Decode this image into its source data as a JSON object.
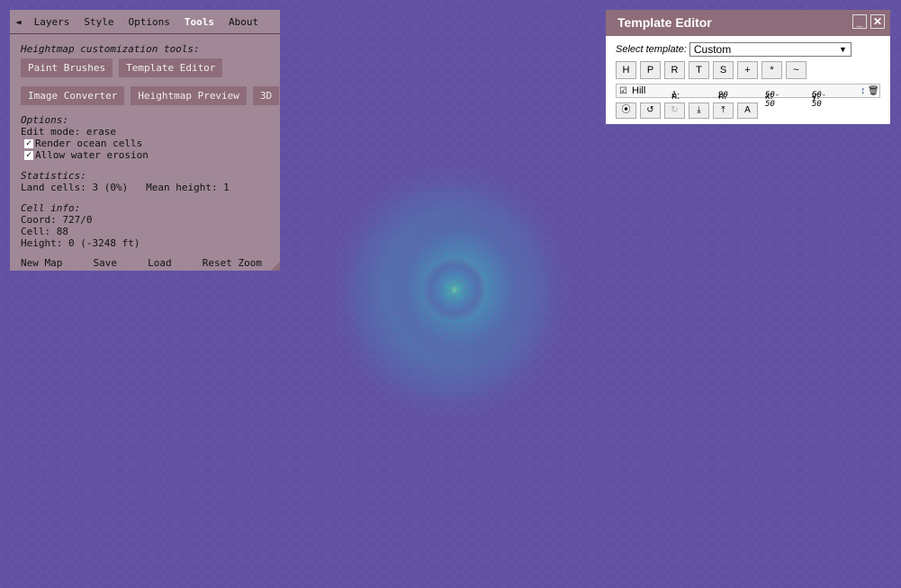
{
  "colors": {
    "ocean": "#6251a3",
    "panel": "#a58c96",
    "panel_button": "#8e6c79",
    "title_bar": "#8e6c79"
  },
  "tabs": {
    "collapse_icon": "◄",
    "items": [
      "Layers",
      "Style",
      "Options",
      "Tools",
      "About"
    ],
    "active": "Tools"
  },
  "tools": {
    "heading": "Heightmap customization tools:",
    "buttons_row1": [
      "Paint Brushes",
      "Template Editor"
    ],
    "buttons_row2": [
      "Image Converter",
      "Heightmap Preview",
      "3D"
    ]
  },
  "options": {
    "heading": "Options:",
    "edit_mode": "Edit mode: erase",
    "render_ocean": {
      "label": "Render ocean cells",
      "checked": true
    },
    "water_erosion": {
      "label": "Allow water erosion",
      "checked": true
    },
    "check_glyph": "✓"
  },
  "statistics": {
    "heading": "Statistics:",
    "land_cells": "Land cells: 3 (0%)",
    "mean_height": "Mean height: 1"
  },
  "cell_info": {
    "heading": "Cell info:",
    "coord": "Coord: 727/0",
    "cell": "Cell: 88",
    "height": "Height: 0 (-3248 ft)"
  },
  "footer": [
    "New Map",
    "Save",
    "Load",
    "Reset Zoom"
  ],
  "template_editor": {
    "title": "Template Editor",
    "minimize": "_",
    "close": "✕",
    "select_label": "Select template:",
    "selected": "Custom",
    "select_arrow": "▼",
    "step_buttons": [
      "H",
      "P",
      "R",
      "T",
      "S",
      "+",
      "*",
      "~"
    ],
    "step": {
      "checkbox": "☑",
      "name": "Hill",
      "n_label": "n:",
      "n": "1",
      "h_label": "h:",
      "h": "20",
      "x_label": "x:",
      "x": "50-50",
      "y_label": "y:",
      "y": "50-50",
      "drag_icon": "↕",
      "delete_icon": "🗑"
    },
    "action_buttons": [
      {
        "name": "run-icon",
        "glyph": "⦿"
      },
      {
        "name": "undo-icon",
        "glyph": "↺"
      },
      {
        "name": "redo-icon",
        "glyph": "↻"
      },
      {
        "name": "download-icon",
        "glyph": "⤓"
      },
      {
        "name": "upload-icon",
        "glyph": "⤒"
      },
      {
        "name": "config-icon",
        "glyph": "A"
      }
    ]
  }
}
